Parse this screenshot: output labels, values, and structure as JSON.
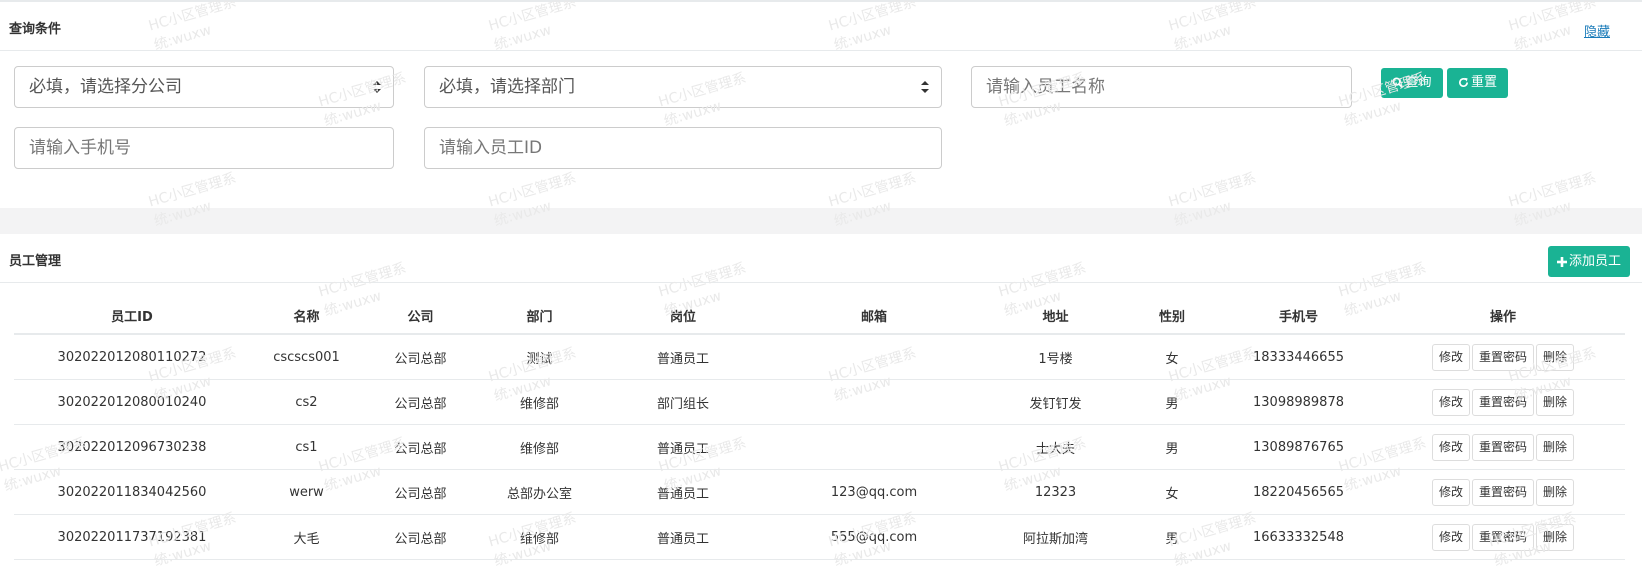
{
  "query": {
    "title": "查询条件",
    "hide_link": "隐藏",
    "company_select": "必填，请选择分公司",
    "dept_select": "必填，请选择部门",
    "name_placeholder": "请输入员工名称",
    "phone_placeholder": "请输入手机号",
    "id_placeholder": "请输入员工ID",
    "search_button": "查询",
    "reset_button": "重置"
  },
  "staff": {
    "title": "员工管理",
    "add_button": "添加员工",
    "columns": [
      "员工ID",
      "名称",
      "公司",
      "部门",
      "岗位",
      "邮箱",
      "地址",
      "性别",
      "手机号",
      "操作"
    ],
    "rows": [
      {
        "id": "302022012080110272",
        "name": "cscscs001",
        "company": "公司总部",
        "dept": "测试",
        "position": "普通员工",
        "email": "",
        "address": "1号楼",
        "gender": "女",
        "phone": "18333446655"
      },
      {
        "id": "302022012080010240",
        "name": "cs2",
        "company": "公司总部",
        "dept": "维修部",
        "position": "部门组长",
        "email": "",
        "address": "发钉钉发",
        "gender": "男",
        "phone": "13098989878"
      },
      {
        "id": "302022012096730238",
        "name": "cs1",
        "company": "公司总部",
        "dept": "维修部",
        "position": "普通员工",
        "email": "",
        "address": "士大夫",
        "gender": "男",
        "phone": "13089876765"
      },
      {
        "id": "302022011834042560",
        "name": "werw",
        "company": "公司总部",
        "dept": "总部办公室",
        "position": "普通员工",
        "email": "123@qq.com",
        "address": "12323",
        "gender": "女",
        "phone": "18220456565"
      },
      {
        "id": "302022011737192381",
        "name": "大毛",
        "company": "公司总部",
        "dept": "维修部",
        "position": "普通员工",
        "email": "555@qq.com",
        "address": "阿拉斯加湾",
        "gender": "男",
        "phone": "16633332548"
      }
    ],
    "row_actions": {
      "edit": "修改",
      "reset_password": "重置密码",
      "delete": "删除"
    }
  },
  "watermark": {
    "line1": "HC小区管理系",
    "line2": "统:wuxw"
  },
  "colors": {
    "accent": "#1ab394",
    "link": "#1a7bb9"
  },
  "icons": {
    "search": "search-icon",
    "reset": "refresh-icon",
    "add": "plus-icon"
  }
}
